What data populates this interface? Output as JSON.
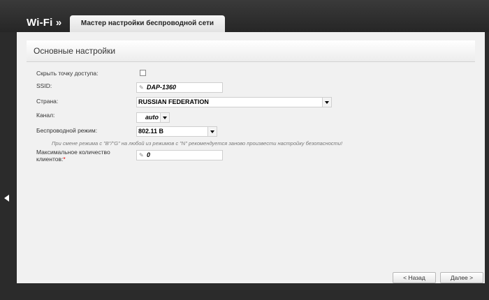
{
  "header": {
    "section": "Wi-Fi »",
    "tab": "Мастер настройки беспроводной сети"
  },
  "panel": {
    "title": "Основные настройки"
  },
  "form": {
    "hide_ap_label": "Скрыть точку доступа:",
    "hide_ap_checked": false,
    "ssid_label": "SSID:",
    "ssid_value": "DAP-1360",
    "country_label": "Страна:",
    "country_value": "RUSSIAN FEDERATION",
    "channel_label": "Канал:",
    "channel_value": "auto",
    "mode_label": "Беспроводной режим:",
    "mode_value": "802.11 B",
    "hint": "При смене режима с \"B\"/\"G\" на любой из режимов с \"N\" рекомендуется заново произвести настройку безопасности!",
    "max_clients_label_line1": "Максимальное количество",
    "max_clients_label_line2": "клиентов:",
    "max_clients_required": "*",
    "max_clients_value": "0"
  },
  "buttons": {
    "back": "< Назад",
    "next": "Далее >"
  },
  "icons": {
    "pencil": "pencil-icon",
    "collapse": "chevron-left-icon"
  }
}
